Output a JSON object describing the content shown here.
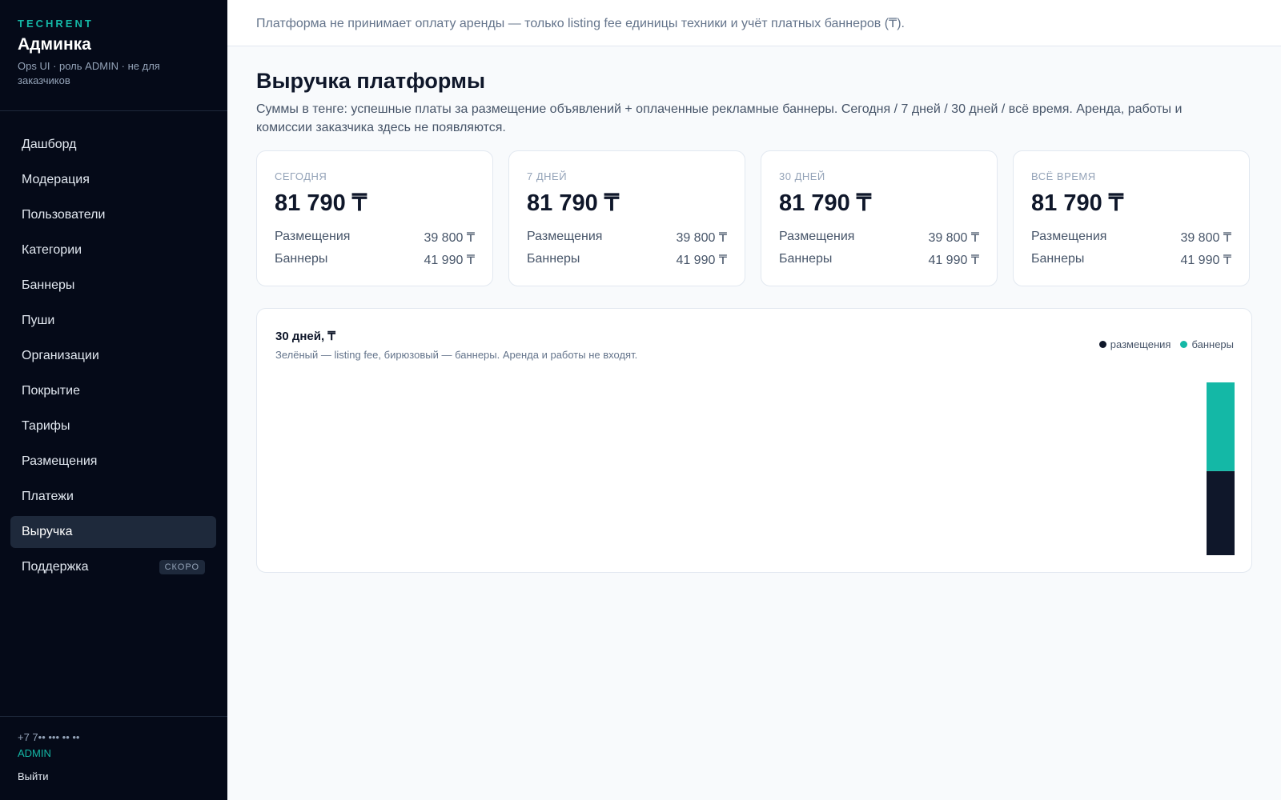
{
  "sidebar": {
    "brand_tag": "TECHRENT",
    "title": "Админка",
    "subtitle": "Ops UI · роль ADMIN · не для заказчиков",
    "items": [
      {
        "label": "Дашборд"
      },
      {
        "label": "Модерация"
      },
      {
        "label": "Пользователи"
      },
      {
        "label": "Категории"
      },
      {
        "label": "Баннеры"
      },
      {
        "label": "Пуши"
      },
      {
        "label": "Организации"
      },
      {
        "label": "Покрытие"
      },
      {
        "label": "Тарифы"
      },
      {
        "label": "Размещения"
      },
      {
        "label": "Платежи"
      },
      {
        "label": "Выручка",
        "active": true
      },
      {
        "label": "Поддержка",
        "badge": "СКОРО"
      }
    ],
    "footer": {
      "phone": "+7 7•• ••• •• ••",
      "role": "ADMIN",
      "logout": "Выйти"
    }
  },
  "topbar": {
    "notice": "Платформа не принимает оплату аренды — только listing fee единицы техники и учёт платных баннеров (₸)."
  },
  "page": {
    "title": "Выручка платформы",
    "description": "Суммы в тенге: успешные платы за размещение объявлений + оплаченные рекламные баннеры. Сегодня / 7 дней / 30 дней / всё время. Аренда, работы и комиссии заказчика здесь не появляются."
  },
  "cards": [
    {
      "label": "СЕГОДНЯ",
      "total": "81 790 ₸",
      "placements_label": "Размещения",
      "placements": "39 800 ₸",
      "banners_label": "Баннеры",
      "banners": "41 990 ₸"
    },
    {
      "label": "7 ДНЕЙ",
      "total": "81 790 ₸",
      "placements_label": "Размещения",
      "placements": "39 800 ₸",
      "banners_label": "Баннеры",
      "banners": "41 990 ₸"
    },
    {
      "label": "30 ДНЕЙ",
      "total": "81 790 ₸",
      "placements_label": "Размещения",
      "placements": "39 800 ₸",
      "banners_label": "Баннеры",
      "banners": "41 990 ₸"
    },
    {
      "label": "ВСЁ ВРЕМЯ",
      "total": "81 790 ₸",
      "placements_label": "Размещения",
      "placements": "39 800 ₸",
      "banners_label": "Баннеры",
      "banners": "41 990 ₸"
    }
  ],
  "chart": {
    "title": "30 дней, ₸",
    "subtitle": "Зелёный — listing fee, бирюзовый — баннеры. Аренда и работы не входят.",
    "legend": [
      {
        "label": "размещения",
        "color": "#0f172a"
      },
      {
        "label": "баннеры",
        "color": "#14b8a6"
      }
    ]
  },
  "chart_data": {
    "type": "bar",
    "stacked": true,
    "days": 30,
    "series": [
      {
        "name": "размещения",
        "color": "#0f172a",
        "values": [
          0,
          0,
          0,
          0,
          0,
          0,
          0,
          0,
          0,
          0,
          0,
          0,
          0,
          0,
          0,
          0,
          0,
          0,
          0,
          0,
          0,
          0,
          0,
          0,
          0,
          0,
          0,
          0,
          0,
          39800
        ]
      },
      {
        "name": "баннеры",
        "color": "#14b8a6",
        "values": [
          0,
          0,
          0,
          0,
          0,
          0,
          0,
          0,
          0,
          0,
          0,
          0,
          0,
          0,
          0,
          0,
          0,
          0,
          0,
          0,
          0,
          0,
          0,
          0,
          0,
          0,
          0,
          0,
          0,
          41990
        ]
      }
    ],
    "ymax": 81790
  }
}
